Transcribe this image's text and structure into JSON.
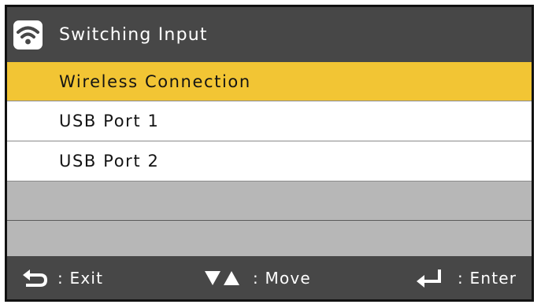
{
  "header": {
    "title": "Switching Input",
    "icon": "wifi-icon"
  },
  "menu": {
    "items": [
      {
        "label": "Wireless Connection",
        "selected": true
      },
      {
        "label": "USB Port 1",
        "selected": false
      },
      {
        "label": "USB Port 2",
        "selected": false
      },
      {
        "label": "",
        "selected": false
      },
      {
        "label": "",
        "selected": false
      }
    ]
  },
  "footer": {
    "exit_label": ": Exit",
    "exit_icon": "back-arrow-icon",
    "move_label": ": Move",
    "move_icon": "down-up-triangles-icon",
    "enter_label": ": Enter",
    "enter_icon": "enter-return-icon"
  },
  "colors": {
    "bar": "#474747",
    "selected": "#f2c534",
    "empty_row": "#b7b7b7",
    "row": "#ffffff"
  }
}
